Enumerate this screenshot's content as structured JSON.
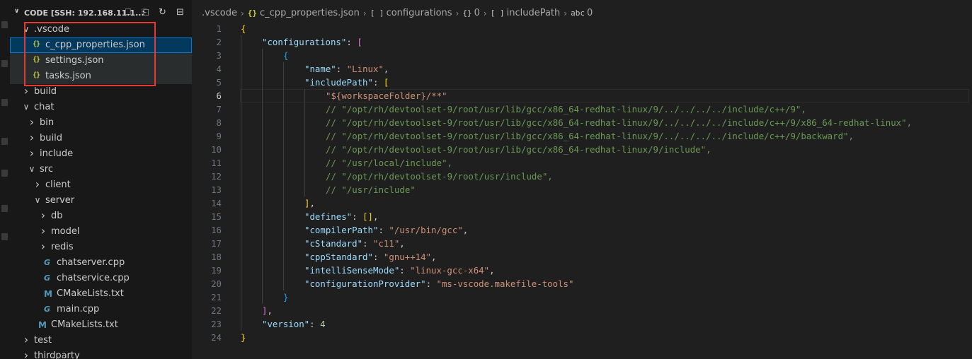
{
  "explorer": {
    "title": "CODE [SSH: 192.168.11.1...",
    "actions": [
      "new-file-icon",
      "new-folder-icon",
      "refresh-icon",
      "collapse-all-icon"
    ],
    "tree": [
      {
        "label": ".vscode",
        "kind": "folder",
        "open": true,
        "depth": 0
      },
      {
        "label": "c_cpp_properties.json",
        "kind": "json",
        "depth": 1,
        "selected": true
      },
      {
        "label": "settings.json",
        "kind": "json",
        "depth": 1
      },
      {
        "label": "tasks.json",
        "kind": "json",
        "depth": 1
      },
      {
        "label": "build",
        "kind": "folder",
        "open": false,
        "depth": 0
      },
      {
        "label": "chat",
        "kind": "folder",
        "open": true,
        "depth": 0
      },
      {
        "label": "bin",
        "kind": "folder",
        "open": false,
        "depth": 1
      },
      {
        "label": "build",
        "kind": "folder",
        "open": false,
        "depth": 1
      },
      {
        "label": "include",
        "kind": "folder",
        "open": false,
        "depth": 1
      },
      {
        "label": "src",
        "kind": "folder",
        "open": true,
        "depth": 1
      },
      {
        "label": "client",
        "kind": "folder",
        "open": false,
        "depth": 2
      },
      {
        "label": "server",
        "kind": "folder",
        "open": true,
        "depth": 2
      },
      {
        "label": "db",
        "kind": "folder",
        "open": false,
        "depth": 3
      },
      {
        "label": "model",
        "kind": "folder",
        "open": false,
        "depth": 3
      },
      {
        "label": "redis",
        "kind": "folder",
        "open": false,
        "depth": 3
      },
      {
        "label": "chatserver.cpp",
        "kind": "cpp",
        "depth": 3
      },
      {
        "label": "chatservice.cpp",
        "kind": "cpp",
        "depth": 3
      },
      {
        "label": "CMakeLists.txt",
        "kind": "cmake",
        "depth": 3
      },
      {
        "label": "main.cpp",
        "kind": "cpp",
        "depth": 3
      },
      {
        "label": "CMakeLists.txt",
        "kind": "cmake",
        "depth": 2
      },
      {
        "label": "test",
        "kind": "folder",
        "open": false,
        "depth": 0
      },
      {
        "label": "thirdparty",
        "kind": "folder",
        "open": false,
        "depth": 0
      }
    ]
  },
  "breadcrumb": [
    {
      "label": ".vscode",
      "icon": ""
    },
    {
      "label": "c_cpp_properties.json",
      "icon": "{}"
    },
    {
      "label": "configurations",
      "icon": "[ ]"
    },
    {
      "label": "0",
      "icon": "{}"
    },
    {
      "label": "includePath",
      "icon": "[ ]"
    },
    {
      "label": "0",
      "icon": "abc"
    }
  ],
  "active_line": 6,
  "code_lines": [
    {
      "n": 1,
      "indent": 0,
      "tokens": [
        [
          "b1",
          "{"
        ]
      ]
    },
    {
      "n": 2,
      "indent": 1,
      "tokens": [
        [
          "k",
          "\"configurations\""
        ],
        [
          "p",
          ": "
        ],
        [
          "b2",
          "["
        ]
      ]
    },
    {
      "n": 3,
      "indent": 2,
      "tokens": [
        [
          "b3",
          "{"
        ]
      ]
    },
    {
      "n": 4,
      "indent": 3,
      "tokens": [
        [
          "k",
          "\"name\""
        ],
        [
          "p",
          ": "
        ],
        [
          "s",
          "\"Linux\""
        ],
        [
          "p",
          ","
        ]
      ]
    },
    {
      "n": 5,
      "indent": 3,
      "tokens": [
        [
          "k",
          "\"includePath\""
        ],
        [
          "p",
          ": "
        ],
        [
          "b1",
          "["
        ]
      ]
    },
    {
      "n": 6,
      "indent": 4,
      "tokens": [
        [
          "s",
          "\"${workspaceFolder}/**\""
        ]
      ]
    },
    {
      "n": 7,
      "indent": 4,
      "tokens": [
        [
          "c",
          "// \"/opt/rh/devtoolset-9/root/usr/lib/gcc/x86_64-redhat-linux/9/../../../../include/c++/9\","
        ]
      ]
    },
    {
      "n": 8,
      "indent": 4,
      "tokens": [
        [
          "c",
          "// \"/opt/rh/devtoolset-9/root/usr/lib/gcc/x86_64-redhat-linux/9/../../../../include/c++/9/x86_64-redhat-linux\","
        ]
      ]
    },
    {
      "n": 9,
      "indent": 4,
      "tokens": [
        [
          "c",
          "// \"/opt/rh/devtoolset-9/root/usr/lib/gcc/x86_64-redhat-linux/9/../../../../include/c++/9/backward\","
        ]
      ]
    },
    {
      "n": 10,
      "indent": 4,
      "tokens": [
        [
          "c",
          "// \"/opt/rh/devtoolset-9/root/usr/lib/gcc/x86_64-redhat-linux/9/include\","
        ]
      ]
    },
    {
      "n": 11,
      "indent": 4,
      "tokens": [
        [
          "c",
          "// \"/usr/local/include\","
        ]
      ]
    },
    {
      "n": 12,
      "indent": 4,
      "tokens": [
        [
          "c",
          "// \"/opt/rh/devtoolset-9/root/usr/include\","
        ]
      ]
    },
    {
      "n": 13,
      "indent": 4,
      "tokens": [
        [
          "c",
          "// \"/usr/include\""
        ]
      ]
    },
    {
      "n": 14,
      "indent": 3,
      "tokens": [
        [
          "b1",
          "]"
        ],
        [
          "p",
          ","
        ]
      ]
    },
    {
      "n": 15,
      "indent": 3,
      "tokens": [
        [
          "k",
          "\"defines\""
        ],
        [
          "p",
          ": "
        ],
        [
          "b1",
          "[]"
        ],
        [
          "p",
          ","
        ]
      ]
    },
    {
      "n": 16,
      "indent": 3,
      "tokens": [
        [
          "k",
          "\"compilerPath\""
        ],
        [
          "p",
          ": "
        ],
        [
          "s",
          "\"/usr/bin/gcc\""
        ],
        [
          "p",
          ","
        ]
      ]
    },
    {
      "n": 17,
      "indent": 3,
      "tokens": [
        [
          "k",
          "\"cStandard\""
        ],
        [
          "p",
          ": "
        ],
        [
          "s",
          "\"c11\""
        ],
        [
          "p",
          ","
        ]
      ]
    },
    {
      "n": 18,
      "indent": 3,
      "tokens": [
        [
          "k",
          "\"cppStandard\""
        ],
        [
          "p",
          ": "
        ],
        [
          "s",
          "\"gnu++14\""
        ],
        [
          "p",
          ","
        ]
      ]
    },
    {
      "n": 19,
      "indent": 3,
      "tokens": [
        [
          "k",
          "\"intelliSenseMode\""
        ],
        [
          "p",
          ": "
        ],
        [
          "s",
          "\"linux-gcc-x64\""
        ],
        [
          "p",
          ","
        ]
      ]
    },
    {
      "n": 20,
      "indent": 3,
      "tokens": [
        [
          "k",
          "\"configurationProvider\""
        ],
        [
          "p",
          ": "
        ],
        [
          "s",
          "\"ms-vscode.makefile-tools\""
        ]
      ]
    },
    {
      "n": 21,
      "indent": 2,
      "tokens": [
        [
          "b3",
          "}"
        ]
      ]
    },
    {
      "n": 22,
      "indent": 1,
      "tokens": [
        [
          "b2",
          "]"
        ],
        [
          "p",
          ","
        ]
      ]
    },
    {
      "n": 23,
      "indent": 1,
      "tokens": [
        [
          "k",
          "\"version\""
        ],
        [
          "p",
          ": "
        ],
        [
          "n",
          "4"
        ]
      ]
    },
    {
      "n": 24,
      "indent": 0,
      "tokens": [
        [
          "b1",
          "}"
        ]
      ]
    }
  ],
  "colors": {
    "sidebar_bg": "#181818",
    "editor_bg": "#1f1f1f",
    "selection": "#04395e",
    "focus_border": "#0078d4",
    "highlight_box": "#e53935",
    "json_icon": "#cbcb41",
    "cpp_icon": "#519aba"
  }
}
